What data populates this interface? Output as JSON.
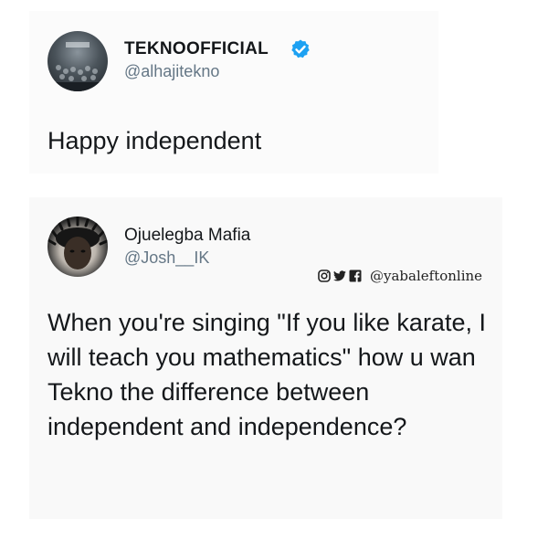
{
  "tweet1": {
    "display_name": "TEKNOOFFICIAL",
    "handle": "@alhajitekno",
    "verified_icon": "verified-badge-icon",
    "text": "Happy independent"
  },
  "tweet2": {
    "display_name": "Ojuelegba Mafia",
    "handle": "@Josh__IK",
    "watermark": {
      "icons": [
        "instagram-icon",
        "twitter-icon",
        "facebook-icon"
      ],
      "handle": "@yabaleftonline"
    },
    "text": "When you're singing \"If you like karate, I will teach you mathematics\" how u wan Tekno the difference between independent and independence?"
  },
  "colors": {
    "verified_blue": "#1da1f2",
    "text": "#14171a",
    "handle_gray": "#657786"
  }
}
